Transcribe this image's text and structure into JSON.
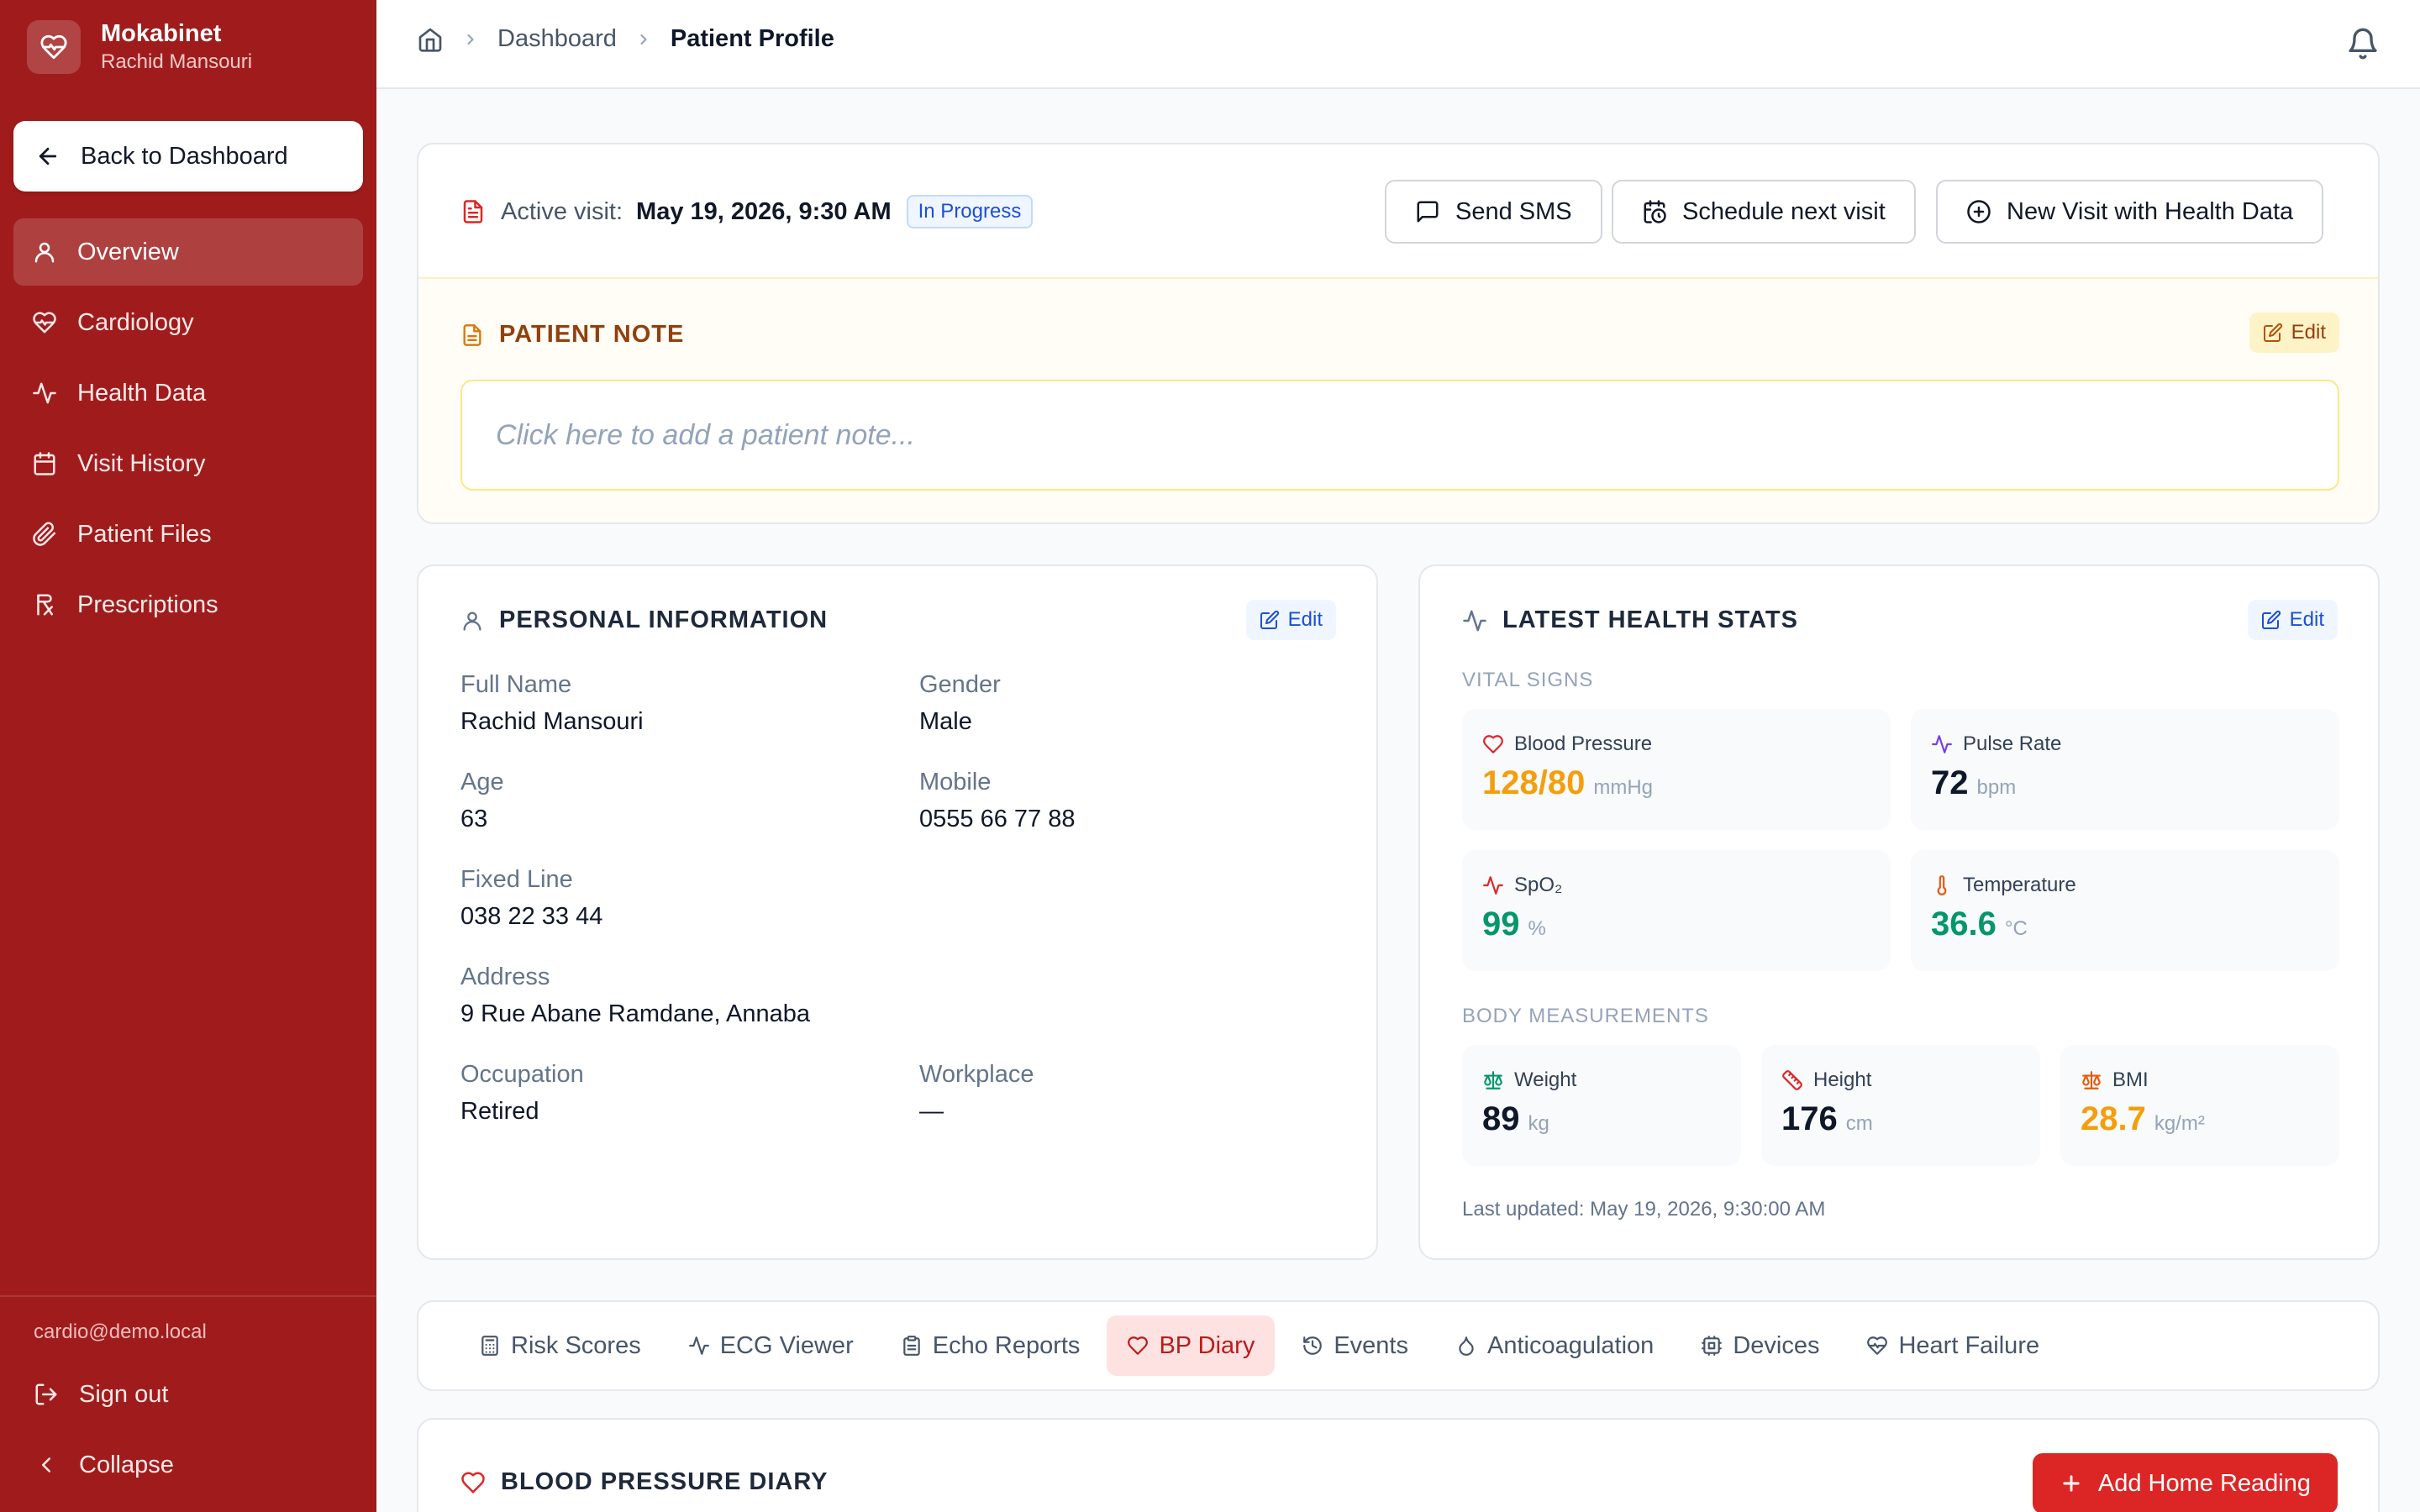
{
  "sidebar": {
    "app_name": "Mokabinet",
    "user_name": "Rachid Mansouri",
    "back_label": "Back to Dashboard",
    "nav": [
      {
        "label": "Overview",
        "icon": "user-icon",
        "active": true
      },
      {
        "label": "Cardiology",
        "icon": "heart-pulse-icon"
      },
      {
        "label": "Health Data",
        "icon": "activity-icon"
      },
      {
        "label": "Visit History",
        "icon": "calendar-icon"
      },
      {
        "label": "Patient Files",
        "icon": "paperclip-icon"
      },
      {
        "label": "Prescriptions",
        "icon": "prescription-icon"
      }
    ],
    "email": "cardio@demo.local",
    "sign_out": "Sign out",
    "collapse": "Collapse"
  },
  "topbar": {
    "breadcrumb": [
      "Dashboard",
      "Patient Profile"
    ]
  },
  "visit": {
    "label": "Active visit:",
    "date": "May 19, 2026, 9:30 AM",
    "status": "In Progress",
    "buttons": {
      "sms": "Send SMS",
      "schedule": "Schedule next visit",
      "new_visit": "New Visit with Health Data"
    }
  },
  "note": {
    "title": "PATIENT NOTE",
    "edit": "Edit",
    "placeholder": "Click here to add a patient note..."
  },
  "personal": {
    "title": "PERSONAL INFORMATION",
    "edit": "Edit",
    "fields": [
      {
        "label": "Full Name",
        "value": "Rachid Mansouri"
      },
      {
        "label": "Gender",
        "value": "Male"
      },
      {
        "label": "Age",
        "value": "63"
      },
      {
        "label": "Mobile",
        "value": "0555 66 77 88"
      },
      {
        "label": "Fixed Line",
        "value": "038 22 33 44"
      },
      {
        "label": "Address",
        "value": "9 Rue Abane Ramdane, Annaba"
      },
      {
        "label": "Occupation",
        "value": "Retired"
      },
      {
        "label": "Workplace",
        "value": "—"
      }
    ]
  },
  "health": {
    "title": "LATEST HEALTH STATS",
    "edit": "Edit",
    "vitals_title": "VITAL SIGNS",
    "vitals": [
      {
        "label": "Blood Pressure",
        "value": "128/80",
        "unit": "mmHg",
        "color": "#f59e0b",
        "icon": "heart-icon"
      },
      {
        "label": "Pulse Rate",
        "value": "72",
        "unit": "bpm",
        "color": "#0f172a",
        "icon": "pulse-icon"
      },
      {
        "label": "SpO₂",
        "value": "99",
        "unit": "%",
        "color": "#059669",
        "icon": "activity-icon"
      },
      {
        "label": "Temperature",
        "value": "36.6",
        "unit": "°C",
        "color": "#059669",
        "icon": "thermometer-icon"
      }
    ],
    "body_title": "BODY MEASUREMENTS",
    "body": [
      {
        "label": "Weight",
        "value": "89",
        "unit": "kg",
        "color": "#0f172a",
        "icon": "scale-icon"
      },
      {
        "label": "Height",
        "value": "176",
        "unit": "cm",
        "color": "#0f172a",
        "icon": "ruler-icon"
      },
      {
        "label": "BMI",
        "value": "28.7",
        "unit": "kg/m²",
        "color": "#f59e0b",
        "icon": "scale-icon"
      }
    ],
    "updated": "Last updated: May 19, 2026, 9:30:00 AM"
  },
  "tabs": [
    {
      "label": "Risk Scores",
      "icon": "calculator-icon"
    },
    {
      "label": "ECG Viewer",
      "icon": "activity-icon"
    },
    {
      "label": "Echo Reports",
      "icon": "clipboard-icon"
    },
    {
      "label": "BP Diary",
      "icon": "heart-icon",
      "active": true
    },
    {
      "label": "Events",
      "icon": "history-icon"
    },
    {
      "label": "Anticoagulation",
      "icon": "droplet-icon"
    },
    {
      "label": "Devices",
      "icon": "cpu-icon"
    },
    {
      "label": "Heart Failure",
      "icon": "heart-pulse-icon"
    }
  ],
  "bp": {
    "title": "BLOOD PRESSURE DIARY",
    "add_label": "Add Home Reading"
  },
  "colors": {
    "sidebar_bg": "#a01c1c",
    "accent_red": "#dc2626",
    "link_blue": "#1d4ed8",
    "warning": "#f59e0b",
    "success": "#059669"
  }
}
